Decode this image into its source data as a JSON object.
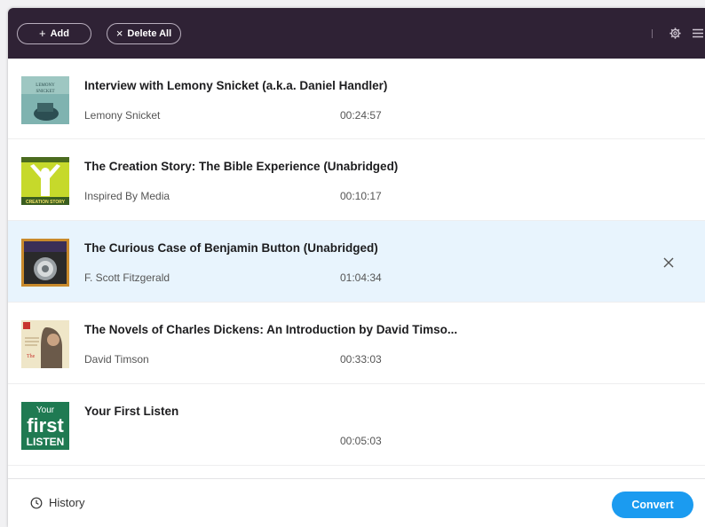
{
  "toolbar": {
    "add_label": "Add",
    "add_icon": "plus-icon",
    "delete_all_label": "Delete All",
    "delete_icon": "x-icon",
    "right_icons": [
      "gear-icon",
      "menu-icon"
    ],
    "background_color": "#2f2235"
  },
  "items": [
    {
      "title": "Interview with Lemony Snicket (a.k.a. Daniel Handler)",
      "author": "Lemony Snicket",
      "duration": "00:24:57",
      "cover_icon": "lemony-snicket-cover"
    },
    {
      "title": "The Creation Story: The Bible Experience (Unabridged)",
      "author": "Inspired By Media",
      "duration": "00:10:17",
      "cover_icon": "creation-story-cover",
      "cover_text": "CREATION STORY"
    },
    {
      "title": "The Curious Case of Benjamin Button (Unabridged)",
      "author": "F. Scott Fitzgerald",
      "duration": "01:04:34",
      "cover_icon": "benjamin-button-cover",
      "selected": true
    },
    {
      "title": "The Novels of Charles Dickens: An Introduction by David Timso...",
      "author": "David Timson",
      "duration": "00:33:03",
      "cover_icon": "charles-dickens-cover"
    },
    {
      "title": "Your First Listen",
      "author": "",
      "duration": "00:05:03",
      "cover_icon": "your-first-listen-cover",
      "cover_lines": [
        "Your",
        "first",
        "LISTEN"
      ]
    }
  ],
  "footer": {
    "history_label": "History",
    "history_icon": "clock-icon",
    "convert_label": "Convert",
    "convert_color": "#1b9bf0"
  },
  "colors": {
    "selected_row": "#e8f4fd"
  }
}
